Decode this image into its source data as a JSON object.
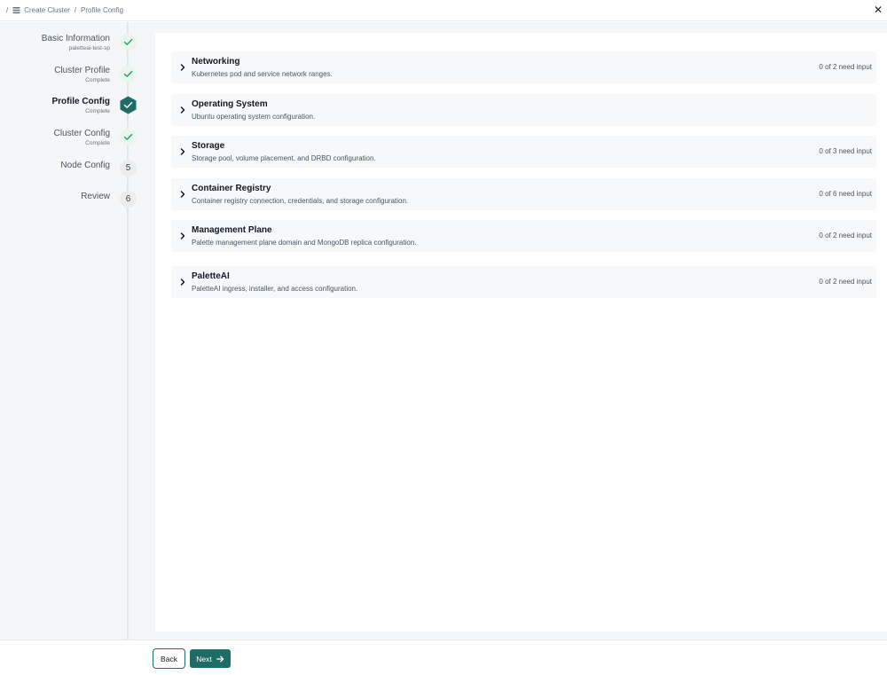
{
  "breadcrumb": {
    "separator_lead": "/",
    "items": [
      "Create Cluster",
      "Profile Config"
    ],
    "separator": "/"
  },
  "steps": [
    {
      "label": "Basic Information",
      "sub": "paletteai-test-sp",
      "state": "done"
    },
    {
      "label": "Cluster Profile",
      "sub": "Complete",
      "state": "done"
    },
    {
      "label": "Profile Config",
      "sub": "Complete",
      "state": "current"
    },
    {
      "label": "Cluster Config",
      "sub": "Complete",
      "state": "done"
    },
    {
      "label": "Node Config",
      "sub": "",
      "state": "pending",
      "number": "5"
    },
    {
      "label": "Review",
      "sub": "",
      "state": "pending",
      "number": "6"
    }
  ],
  "sections": [
    {
      "title": "Networking",
      "description": "Kubernetes pod and service network ranges.",
      "status": "0 of 2 need input"
    },
    {
      "title": "Operating System",
      "description": "Ubuntu operating system configuration.",
      "status": ""
    },
    {
      "title": "Storage",
      "description": "Storage pool, volume placement, and DRBD configuration.",
      "status": "0 of 3 need input"
    },
    {
      "title": "Container Registry",
      "description": "Container registry connection, credentials, and storage configuration.",
      "status": "0 of 6 need input"
    },
    {
      "title": "Management Plane",
      "description": "Palette management plane domain and MongoDB replica configuration.",
      "status": "0 of 2 need input"
    },
    {
      "title": "PaletteAI",
      "description": "PaletteAI ingress, installer, and access configuration.",
      "status": "0 of 2 need input"
    }
  ],
  "footer": {
    "back_label": "Back",
    "next_label": "Next"
  },
  "icons": {
    "close": "close-icon",
    "cluster": "cluster-icon",
    "check": "check-icon",
    "chevron": "chevron-right-icon",
    "arrow": "arrow-right-icon"
  },
  "colors": {
    "accent": "#1f6b66",
    "done_bg": "#e9f6ee",
    "check": "#22a35a"
  }
}
